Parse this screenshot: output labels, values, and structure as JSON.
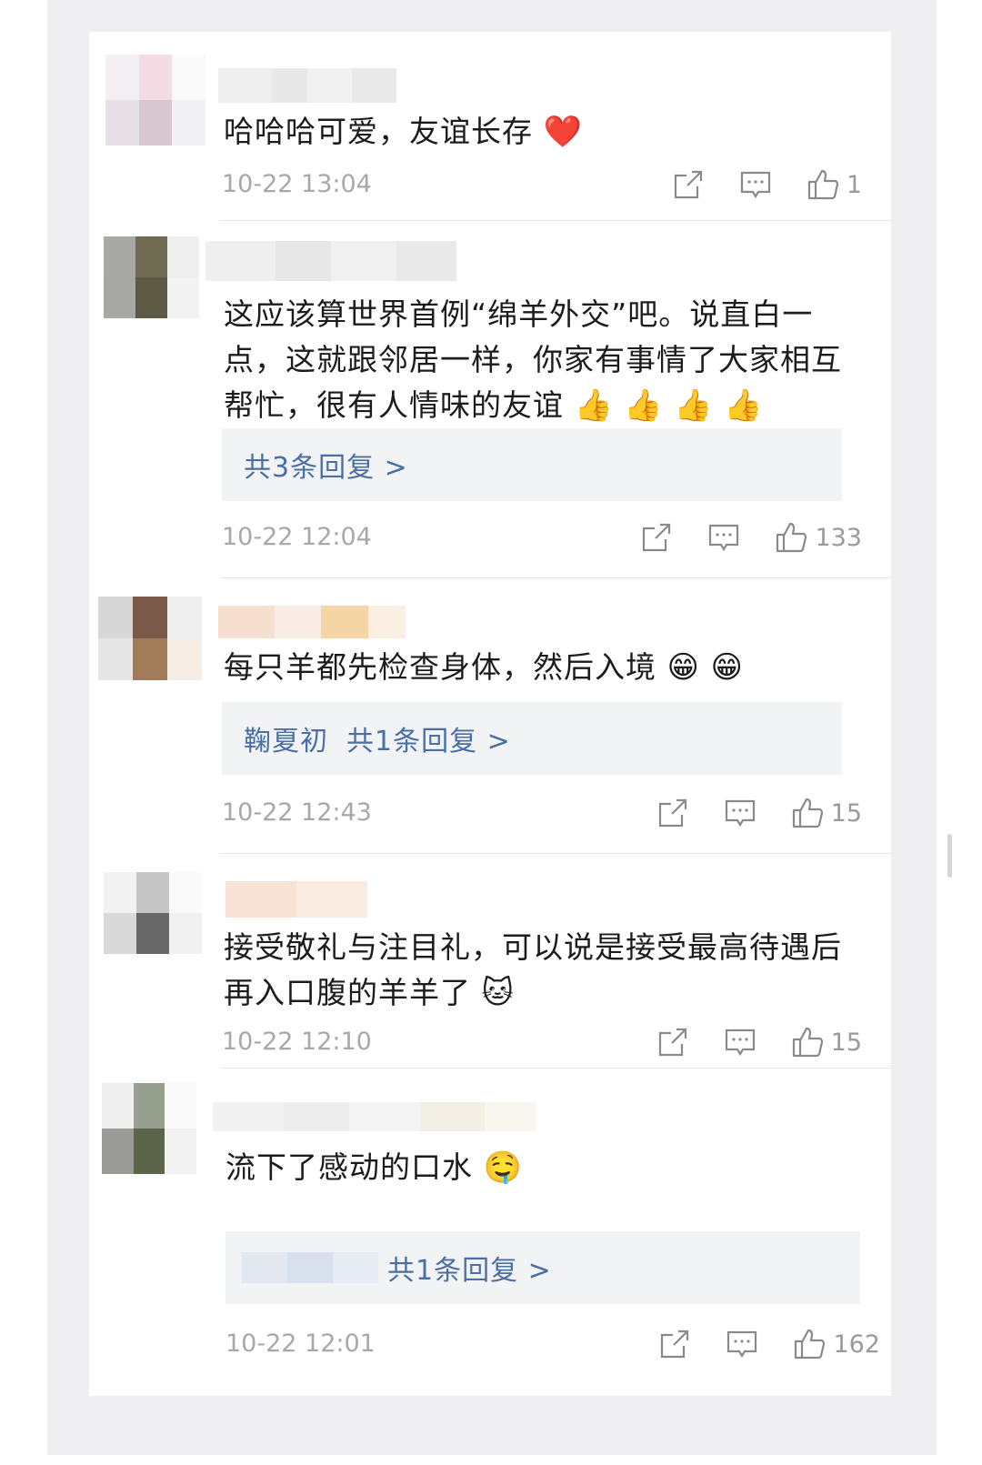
{
  "comments": [
    {
      "text": "哈哈哈可爱，友谊长存",
      "emojis": [
        "❤️"
      ],
      "time": "10-22 13:04",
      "likes": "1",
      "reply": null
    },
    {
      "text": "这应该算世界首例“绵羊外交”吧。说直白一点，这就跟邻居一样，你家有事情了大家相互帮忙，很有人情味的友谊",
      "emojis": [
        "👍",
        "👍",
        "👍",
        "👍"
      ],
      "time": "10-22 12:04",
      "likes": "133",
      "reply": {
        "name": "",
        "label": "共3条回复 >"
      }
    },
    {
      "text": "每只羊都先检查身体，然后入境",
      "emojis": [
        "😁",
        "😁"
      ],
      "time": "10-22 12:43",
      "likes": "15",
      "reply": {
        "name": "鞠夏初",
        "label": "共1条回复 >"
      }
    },
    {
      "text": "接受敬礼与注目礼，可以说是接受最高待遇后再入口腹的羊羊了",
      "emojis": [
        "🐱"
      ],
      "time": "10-22 12:10",
      "likes": "15",
      "reply": null
    },
    {
      "text": "流下了感动的口水",
      "emojis": [
        "🤤"
      ],
      "time": "10-22 12:01",
      "likes": "162",
      "reply": {
        "name": "",
        "label": "共1条回复 >"
      }
    }
  ],
  "icons": {
    "share": "share-icon",
    "comment": "comment-icon",
    "like": "thumbs-up-icon"
  },
  "colors": {
    "reply_link": "#4a6fa5",
    "timestamp": "#a8a8a8",
    "text": "#1c1c1c"
  }
}
